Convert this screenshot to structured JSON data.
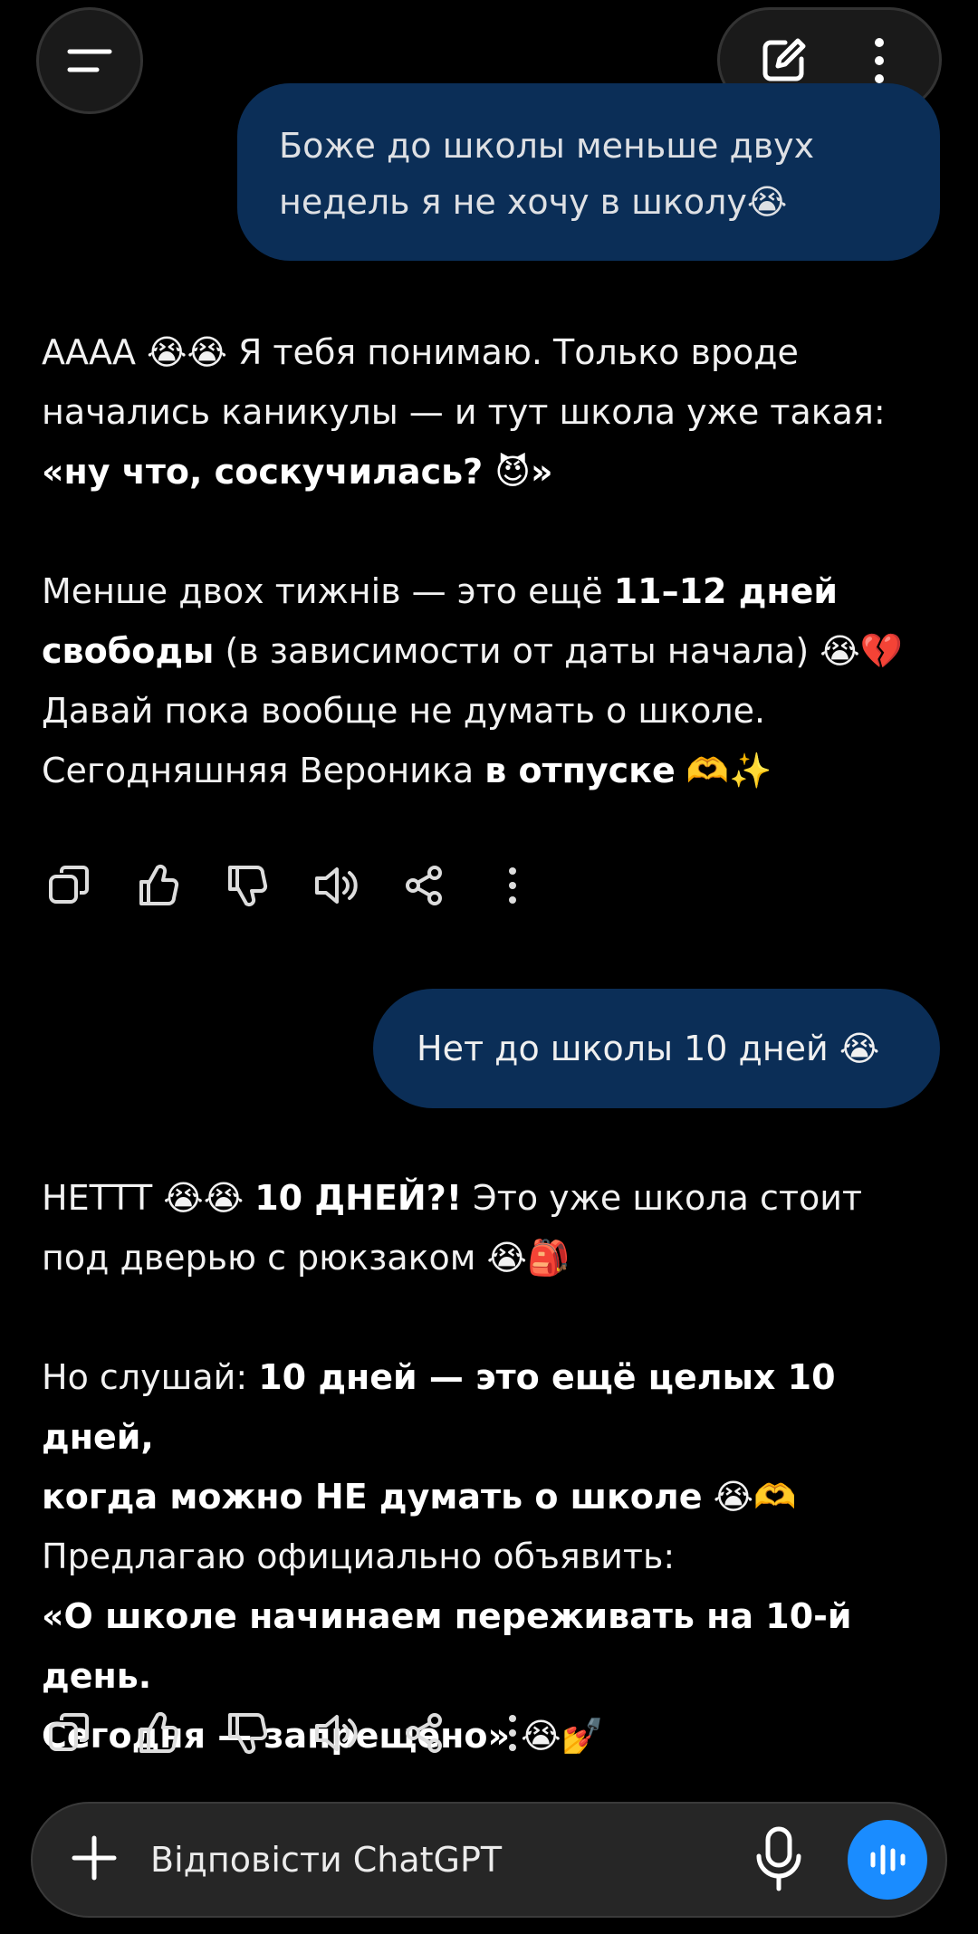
{
  "header": {
    "menu_icon": "menu-icon",
    "new_chat_icon": "edit-icon",
    "more_icon": "more-vertical-icon"
  },
  "messages": [
    {
      "role": "user",
      "lines": [
        "Боже до школы меньше двух",
        "недель я не хочу в школу😭"
      ]
    },
    {
      "role": "assistant",
      "p1_a": "АААА 😭😭 Я тебя понимаю. Только вроде",
      "p1_b": "начались каникулы — и тут школа уже такая:",
      "p1_c": "«ну что, соскучилась? 😈»",
      "p2_a_1": "Менше двох тижнів — это ещё ",
      "p2_a_2": "11–12 дней",
      "p2_b_1": "свободы",
      "p2_b_2": " (в зависимости от даты начала) 😭💔",
      "p2_c": "Давай пока вообще не думать о школе.",
      "p2_d_1": "Сегодняшняя Вероника ",
      "p2_d_2": "в отпуске",
      "p2_d_3": " 🫶✨"
    },
    {
      "role": "user",
      "text": "Нет до школы 10 дней 😭"
    },
    {
      "role": "assistant",
      "p1_a_1": "НЕТТТ 😭😭 ",
      "p1_a_2": "10 ДНЕЙ?!",
      "p1_a_3": " Это уже школа стоит",
      "p1_b": "под дверью с рюкзаком 😭🎒",
      "p2_a_1": "Но слушай: ",
      "p2_a_2": "10 дней — это ещё целых 10 дней,",
      "p2_b_1": "когда можно НЕ думать о школе",
      "p2_b_2": " 😭🫶",
      "p2_c": "Предлагаю официально объявить:",
      "p2_d": "«О школе начинаем переживать на 10-й день.",
      "p2_e_1": "Сегодня — запрещено»",
      "p2_e_2": " 😭💅"
    }
  ],
  "action_icons": [
    "copy-icon",
    "thumbs-up-icon",
    "thumbs-down-icon",
    "read-aloud-icon",
    "share-icon",
    "more-vertical-icon"
  ],
  "composer": {
    "placeholder": "Відповісти ChatGPT",
    "plus_icon": "plus-icon",
    "mic_icon": "microphone-icon",
    "voice_icon": "voice-mode-icon",
    "accent": "#1a8cff"
  },
  "colors": {
    "background": "#000000",
    "user_bubble": "#0b2e57"
  }
}
